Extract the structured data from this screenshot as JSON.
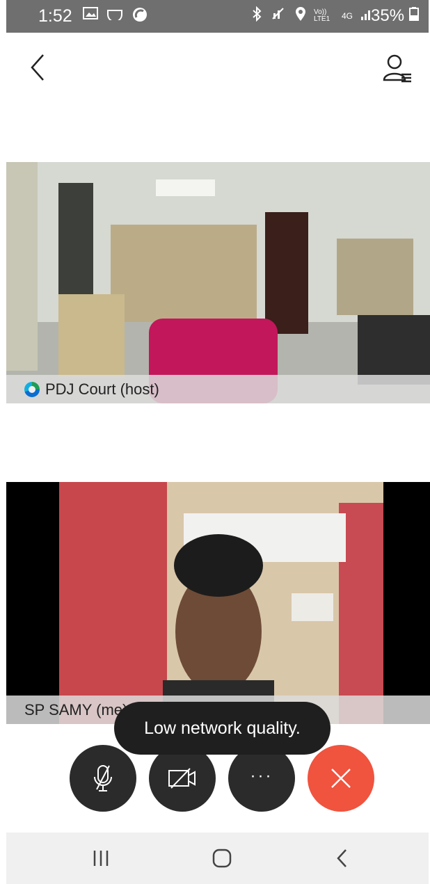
{
  "status_bar": {
    "time": "1:52",
    "left_icons": [
      "gallery-icon",
      "voicemail-icon",
      "sync-icon"
    ],
    "right_icons": [
      "bluetooth-icon",
      "mute-signal-icon",
      "location-icon"
    ],
    "network_volte": "Vo)) LTE1",
    "network_type": "4G",
    "battery_percent": "35%"
  },
  "header": {
    "back_icon": "chevron-left-icon",
    "participants_icon": "participants-list-icon"
  },
  "videos": {
    "host": {
      "name": "PDJ Court (host)"
    },
    "me": {
      "name": "SP SAMY (me)"
    }
  },
  "toast": {
    "message": "Low network quality."
  },
  "controls": {
    "mute_icon": "microphone-off-icon",
    "video_icon": "video-off-icon",
    "more_label": "···",
    "end_icon": "close-icon",
    "end_color": "#f0533e"
  },
  "nav_bar": {
    "recent_icon": "recent-apps-icon",
    "home_icon": "home-icon",
    "back_icon": "back-icon"
  }
}
